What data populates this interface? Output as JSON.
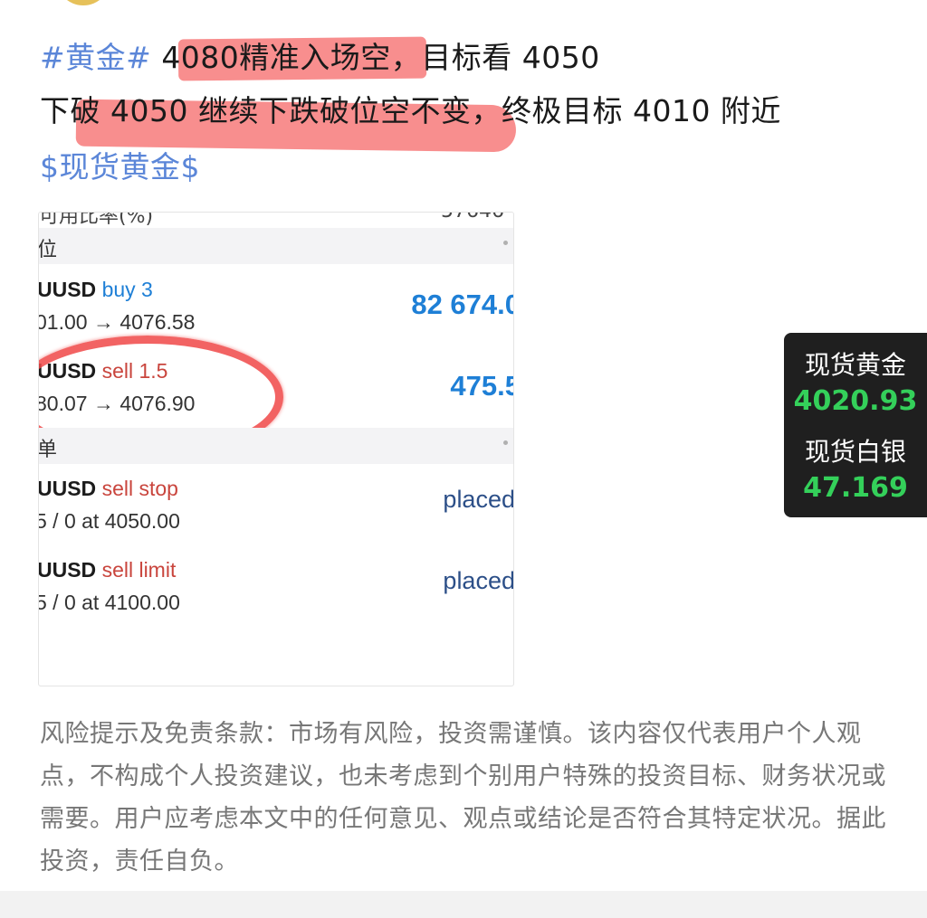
{
  "post": {
    "hashtag": "#黄金#",
    "line1_highlight": "4080精准入场空",
    "line1_rest": "，目标看 4050",
    "line2": "下破 4050 继续下跌破位空不变，终极目标 4010 附近",
    "cashtag": "$现货黄金$"
  },
  "screenshot": {
    "top_cut_left": "可用比率(%)",
    "top_cut_right": "57646",
    "positions_label": "位",
    "orders_label": "单",
    "positions": [
      {
        "symbol": "UUSD",
        "side": "buy 3",
        "detail": "01.00 → 4076.58",
        "profit": "82 674.0"
      },
      {
        "symbol": "UUSD",
        "side": "sell 1.5",
        "detail": "80.07 → 4076.90",
        "profit": "475.5"
      }
    ],
    "orders": [
      {
        "symbol": "UUSD",
        "side": "sell stop",
        "detail": "5 / 0 at 4050.00",
        "status": "placed"
      },
      {
        "symbol": "UUSD",
        "side": "sell limit",
        "detail": "5 / 0 at 4100.00",
        "status": "placed"
      }
    ]
  },
  "disclaimer": "风险提示及免责条款：市场有风险，投资需谨慎。该内容仅代表用户个人观点，不构成个人投资建议，也未考虑到个别用户特殊的投资目标、财务状况或需要。用户应考虑本文中的任何意见、观点或结论是否符合其特定状况。据此投资，责任自负。",
  "ticker": {
    "gold_label": "现货黄金",
    "gold_price": "4020.93",
    "silver_label": "现货白银",
    "silver_price": "47.169"
  },
  "colors": {
    "hashtag": "#5b86d8",
    "highlight": "#f56262",
    "buy": "#1e7fd6",
    "sell": "#c9453d",
    "ticker_bg": "#1f1f1f",
    "ticker_price": "#34d05a"
  }
}
